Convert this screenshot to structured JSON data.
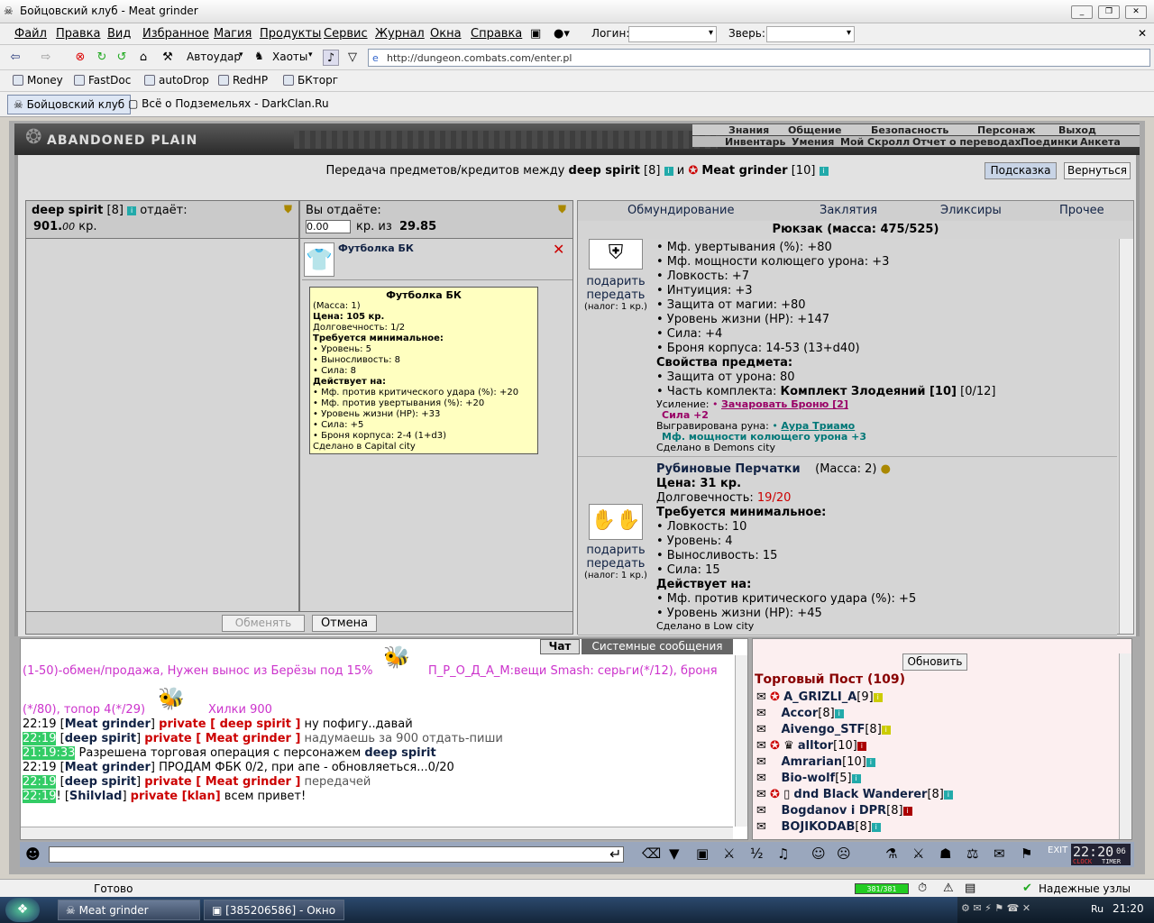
{
  "window": {
    "title": "Бойцовский клуб - Meat grinder"
  },
  "menu": {
    "items": [
      "Файл",
      "Правка",
      "Вид",
      "Избранное",
      "Магия",
      "Продукты",
      "Сервис",
      "Журнал",
      "Окна",
      "Справка"
    ],
    "login_label": "Логин:",
    "pet_label": "Зверь:"
  },
  "toolbar": {
    "autohit": "Автоудар",
    "chaos": "Хаоты",
    "address": "http://dungeon.combats.com/enter.pl"
  },
  "links": [
    "Money",
    "FastDoc",
    "autoDrop",
    "RedHP",
    "БКторг"
  ],
  "tabs": [
    "Бойцовский клуб",
    "Всё о Подземельях - DarkClan.Ru"
  ],
  "game": {
    "logo": "ABANDONED PLAIN",
    "nav1": [
      "Знания",
      "Общение",
      "Безопасность",
      "Персонаж",
      "Выход"
    ],
    "nav2": [
      "Инвентарь",
      "Умения",
      "Мой Скролл",
      "Отчет о переводах",
      "Поединки",
      "Анкета"
    ],
    "header": {
      "pre": "Передача предметов/кредитов между",
      "user1": "deep spirit",
      "lvl1": "[8]",
      "and": "и",
      "user2": "Meat grinder",
      "lvl2": "[10]"
    },
    "hint_button": "Подсказка",
    "back_button": "Вернуться",
    "left": {
      "user": "deep spirit",
      "lvl": "[8]",
      "gives": "отдаёт:",
      "amount_int": "901.",
      "amount_dec": "00",
      "currency": "кр."
    },
    "mid": {
      "you_give": "Вы отдаёте:",
      "input_value": "0.00",
      "of": "кр. из",
      "total": "29.85",
      "item_name": "Футболка БК",
      "tooltip": {
        "title": "Футболка БК",
        "mass": "(Масса: 1)",
        "price": "Цена: 105 кр.",
        "durability": "Долговечность: 1/2",
        "req_title": "Требуется минимальное:",
        "req": [
          "• Уровень: 5",
          "• Выносливость: 8",
          "• Сила: 8"
        ],
        "acts_title": "Действует на:",
        "acts": [
          "• Мф. против критического удара (%): +20",
          "• Мф. против увертывания (%): +20",
          "• Уровень жизни (HP): +33",
          "• Сила: +5",
          "• Броня корпуса: 2-4 (1+d3)"
        ],
        "made": "Сделано в Capital city"
      }
    },
    "exchange_button": "Обменять",
    "cancel_button": "Отмена",
    "right": {
      "tabs": [
        "Обмундирование",
        "Заклятия",
        "Эликсиры",
        "Прочее"
      ],
      "rucksack": "Рюкзак (масса: 475/525)",
      "gift": "подарить",
      "transfer": "передать",
      "tax": "(налог: 1 кр.)",
      "item1_lines": [
        "• Мф. увертывания (%): +80",
        "• Мф. мощности колющего урона: +3",
        "• Ловкость: +7",
        "• Интуиция: +3",
        "• Защита от магии: +80",
        "• Уровень жизни (HP): +147",
        "• Сила: +4",
        "• Броня корпуса: 14-53 (13+d40)"
      ],
      "item1_props_title": "Свойства предмета:",
      "item1_props": [
        "• Защита от урона: 80"
      ],
      "item1_set_label": "• Часть комплекта:",
      "item1_set": "Комплект Злодеяний [10]",
      "item1_set_count": "[0/12]",
      "item1_boost_label": "Усиление:",
      "item1_boost": "Зачаровать Броню [2]",
      "item1_boost_val": "Сила +2",
      "item1_rune_label": "Выгравирована руна:",
      "item1_rune": "Аура Триамо",
      "item1_rune_val": "Мф. мощности колющего урона +3",
      "item1_made": "Сделано в Demons city",
      "item2_name": "Рубиновые Перчатки",
      "item2_mass": "(Масса: 2)",
      "item2_price": "Цена: 31 кр.",
      "item2_dur_label": "Долговечность:",
      "item2_dur": "19/20",
      "item2_req_title": "Требуется минимальное:",
      "item2_req": [
        "• Ловкость: 10",
        "• Уровень: 4",
        "• Выносливость: 15",
        "• Сила: 15"
      ],
      "item2_acts_title": "Действует на:",
      "item2_acts": [
        "• Мф. против критического удара (%): +5",
        "• Уровень жизни (HP): +45"
      ],
      "item2_made": "Сделано в Low city"
    },
    "chat": {
      "tabs": [
        "Чат",
        "Системные сообщения"
      ],
      "ad1": "(1-50)-обмен/продажа, Нужен вынос из Берёзы под 15%",
      "ad2": "П_Р_О_Д_А_М:вещи Smash: серьги(*/12), броня",
      "ad3": "(*/80), топор 4(*/29)",
      "ad4": "Хилки 900",
      "lines": [
        {
          "time": "22:19",
          "hl": false,
          "from": "Meat grinder",
          "priv": "private [ deep spirit ]",
          "msg": "ну пофигу..давай"
        },
        {
          "time": "22:19",
          "hl": true,
          "from": "deep spirit",
          "priv": "private [ Meat grinder ]",
          "msg": "надумаешь за 900 отдать-пиши"
        },
        {
          "time": "21:19:33",
          "hl": true,
          "sys": "Разрешена торговая операция с персонажем",
          "sysname": "deep spirit"
        },
        {
          "time": "22:19",
          "hl": false,
          "from": "Meat grinder",
          "msg": "ПРОДАМ ФБК 0/2, при апе - обновляеться...0/20"
        },
        {
          "time": "22:19",
          "hl": true,
          "from": "deep spirit",
          "priv": "private [ Meat grinder ]",
          "msg": "передачей"
        },
        {
          "time": "22:19",
          "hl": true,
          "from": "Shilvlad",
          "priv": "private [klan]",
          "msg": "всем привет!"
        }
      ]
    },
    "users": {
      "refresh_button": "Обновить",
      "title": "Торговый Пост (109)",
      "list": [
        {
          "name": "A_GRIZLI_A",
          "lvl": "[9]"
        },
        {
          "name": "Accor",
          "lvl": "[8]"
        },
        {
          "name": "Aivengo_STF",
          "lvl": "[8]"
        },
        {
          "name": "alltor",
          "lvl": "[10]"
        },
        {
          "name": "Amrarian",
          "lvl": "[10]"
        },
        {
          "name": "Bio-wolf",
          "lvl": "[5]"
        },
        {
          "name": "dnd Black Wanderer",
          "lvl": "[8]"
        },
        {
          "name": "Bogdanov i DPR",
          "lvl": "[8]"
        },
        {
          "name": "BOJIKODAB",
          "lvl": "[8]"
        }
      ]
    },
    "clock": "22:20",
    "clock_sec": "06",
    "clock_l1": "CLOCK",
    "clock_l2": "TIMER"
  },
  "status": {
    "text": "Готово",
    "bar": "381/381",
    "reliable": "Надежные узлы"
  },
  "taskbar": {
    "task1": "Meat grinder",
    "task2": "[385206586] - Окно ...",
    "lang": "Ru",
    "time": "21:20"
  }
}
